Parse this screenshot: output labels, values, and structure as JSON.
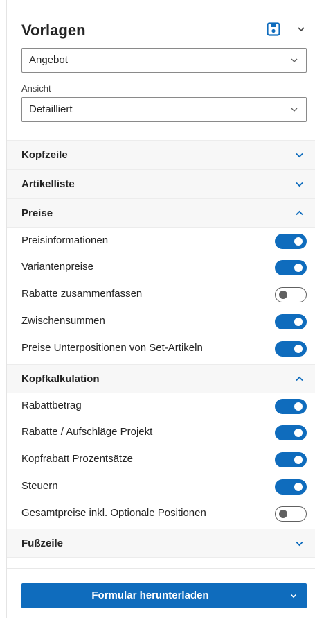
{
  "header": {
    "title": "Vorlagen"
  },
  "template_select": {
    "value": "Angebot"
  },
  "view": {
    "label": "Ansicht",
    "value": "Detailliert"
  },
  "sections": {
    "kopfzeile": {
      "title": "Kopfzeile",
      "expanded": false
    },
    "artikelliste": {
      "title": "Artikelliste",
      "expanded": false
    },
    "preise": {
      "title": "Preise",
      "expanded": true,
      "items": [
        {
          "label": "Preisinformationen",
          "on": true
        },
        {
          "label": "Variantenpreise",
          "on": true
        },
        {
          "label": "Rabatte zusammenfassen",
          "on": false
        },
        {
          "label": "Zwischensummen",
          "on": true
        },
        {
          "label": "Preise Unterpositionen von Set-Artikeln",
          "on": true
        }
      ]
    },
    "kopfkalkulation": {
      "title": "Kopfkalkulation",
      "expanded": true,
      "items": [
        {
          "label": "Rabattbetrag",
          "on": true
        },
        {
          "label": "Rabatte / Aufschläge Projekt",
          "on": true
        },
        {
          "label": "Kopfrabatt Prozentsätze",
          "on": true
        },
        {
          "label": "Steuern",
          "on": true
        },
        {
          "label": "Gesamtpreise inkl. Optionale Positionen",
          "on": false
        }
      ]
    },
    "fusszeile": {
      "title": "Fußzeile",
      "expanded": false
    }
  },
  "footer": {
    "download_label": "Formular herunterladen"
  },
  "colors": {
    "accent": "#0f6cbd",
    "toggle_off": "#616161"
  },
  "icons": {
    "save": "save-icon",
    "chevron": "chevron-down-icon"
  }
}
